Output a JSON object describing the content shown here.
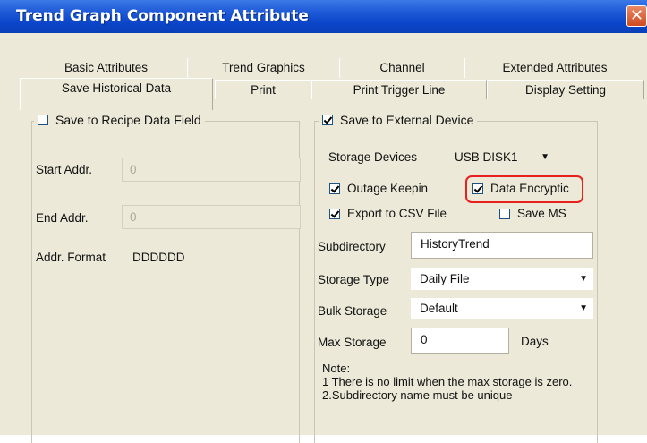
{
  "window": {
    "title": "Trend Graph Component Attribute"
  },
  "tabs": {
    "row1": [
      "Basic Attributes",
      "Trend Graphics",
      "Channel",
      "Extended Attributes"
    ],
    "row2": [
      "Save Historical Data",
      "Print",
      "Print Trigger Line",
      "Display Setting"
    ],
    "active": "Save Historical Data"
  },
  "recipe_group": {
    "title": "Save to Recipe Data Field",
    "checked": false,
    "start_addr_label": "Start Addr.",
    "start_addr_value": "0",
    "end_addr_label": "End Addr.",
    "end_addr_value": "0",
    "addr_format_label": "Addr. Format",
    "addr_format_value": "DDDDDD"
  },
  "external_group": {
    "title": "Save to External Device",
    "checked": true,
    "storage_devices_label": "Storage Devices",
    "storage_devices_value": "USB DISK1",
    "outage_keepin_label": "Outage Keepin",
    "outage_keepin_checked": true,
    "data_encryption_label": "Data Encryptic",
    "data_encryption_checked": true,
    "export_csv_label": "Export to CSV File",
    "export_csv_checked": true,
    "save_ms_label": "Save MS",
    "save_ms_checked": false,
    "subdirectory_label": "Subdirectory",
    "subdirectory_value": "HistoryTrend",
    "storage_type_label": "Storage Type",
    "storage_type_value": "Daily File",
    "bulk_storage_label": "Bulk Storage",
    "bulk_storage_value": "Default",
    "max_storage_label": "Max Storage",
    "max_storage_value": "0",
    "max_storage_unit": "Days",
    "note_title": "Note:",
    "note_line1": "1 There is no limit when the max storage is zero.",
    "note_line2": "2.Subdirectory name must be unique"
  },
  "colors": {
    "highlight": "#e8201e",
    "titlebar": "#0b45c9",
    "dialog_bg": "#ece9d8"
  }
}
